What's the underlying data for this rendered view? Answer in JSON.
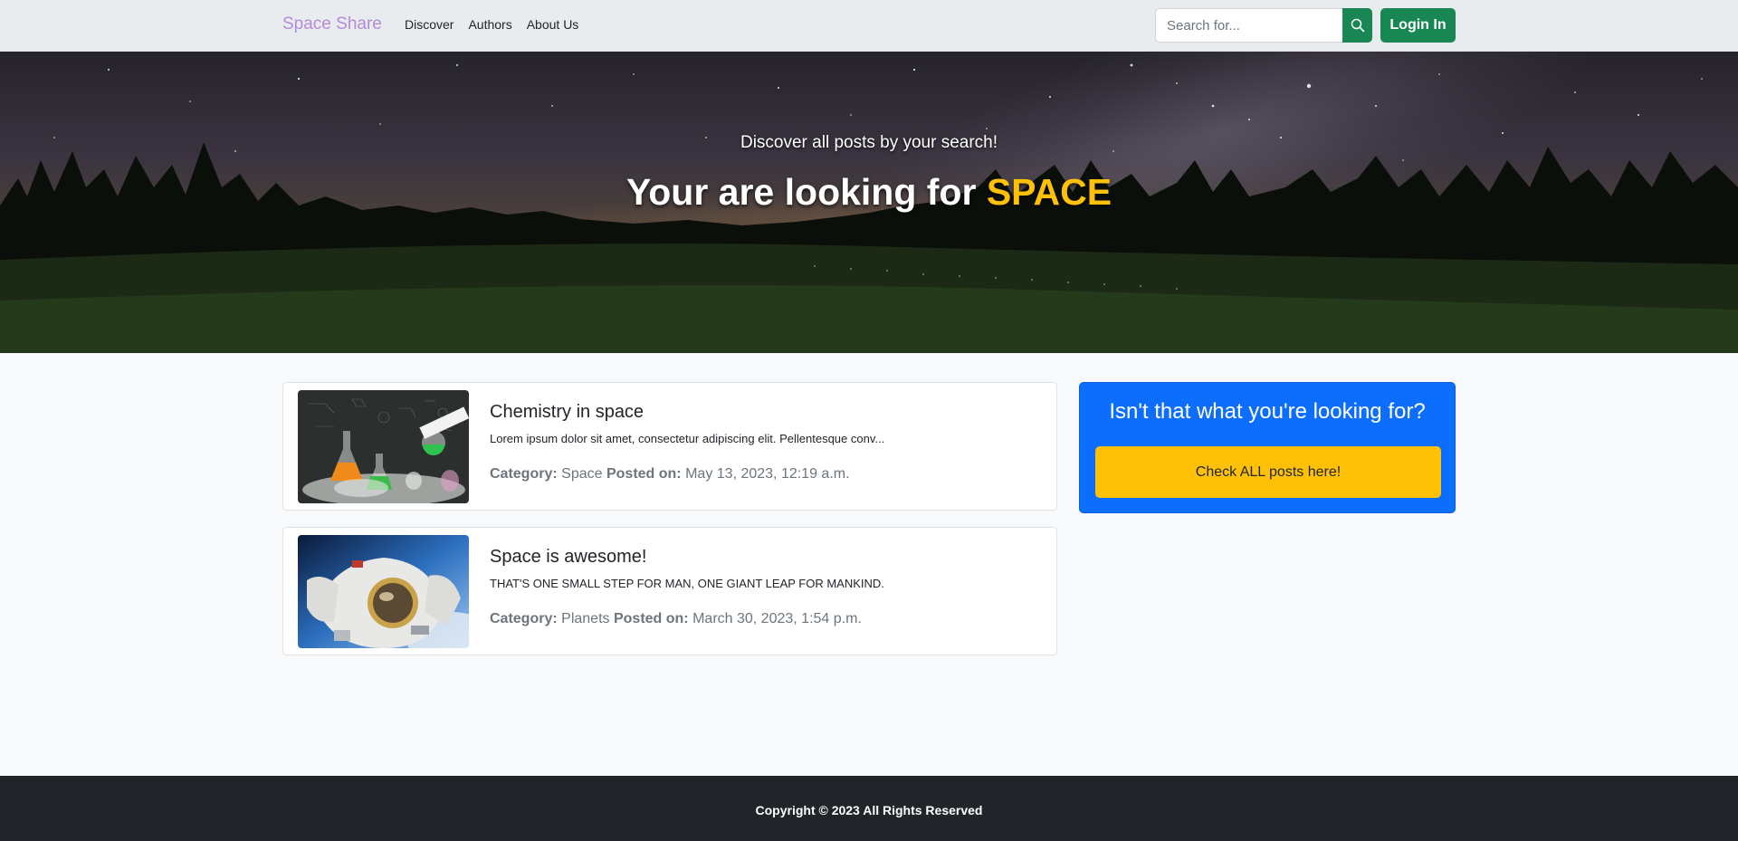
{
  "navbar": {
    "brand": "Space Share",
    "links": [
      "Discover",
      "Authors",
      "About Us"
    ],
    "search_placeholder": "Search for...",
    "search_icon": "search-icon",
    "login_label": "Login In"
  },
  "hero": {
    "subtitle": "Discover all posts by your search!",
    "title_prefix": "Your are looking for ",
    "title_query": "SPACE"
  },
  "posts": [
    {
      "title": "Chemistry in space",
      "excerpt": "Lorem ipsum dolor sit amet, consectetur adipiscing elit. Pellentesque conv...",
      "category_label": "Category:",
      "category": "Space",
      "posted_label": "Posted on:",
      "posted": "May 13, 2023, 12:19 a.m."
    },
    {
      "title": "Space is awesome!",
      "excerpt": "THAT'S ONE SMALL STEP FOR MAN, ONE GIANT LEAP FOR MANKIND.",
      "category_label": "Category:",
      "category": "Planets",
      "posted_label": "Posted on:",
      "posted": "March 30, 2023, 1:54 p.m."
    }
  ],
  "sidebar": {
    "title": "Isn't that what you're looking for?",
    "button_label": "Check ALL posts here!"
  },
  "footer": {
    "copyright": "Copyright © 2023 All Rights Reserved"
  },
  "colors": {
    "brand": "#b58ad9",
    "success": "#198754",
    "primary": "#0d6efd",
    "warning": "#ffc107",
    "footer_bg": "#212529"
  }
}
